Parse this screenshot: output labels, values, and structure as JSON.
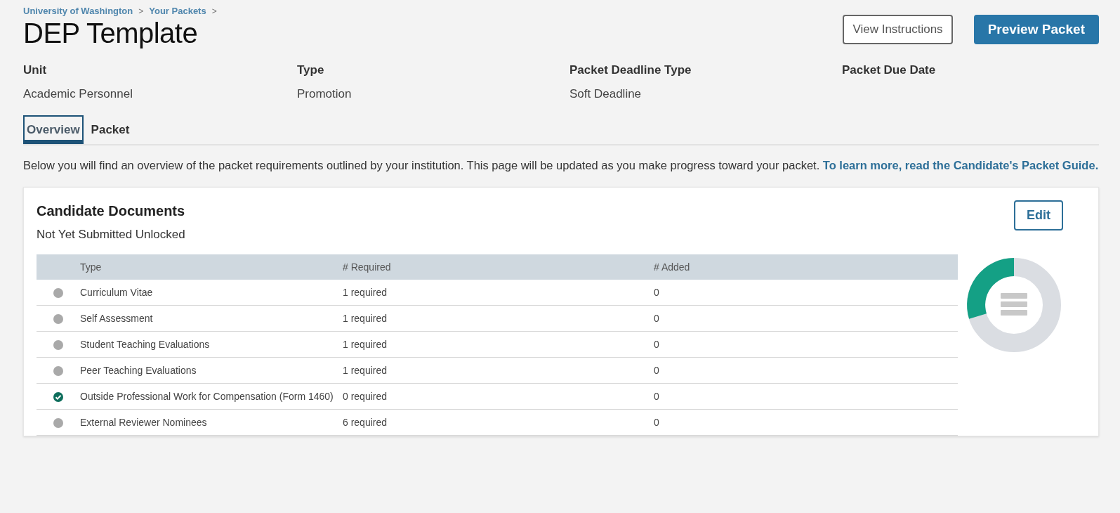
{
  "breadcrumb": [
    "University of Washington",
    "Your Packets"
  ],
  "breadcrumb_separator": ">",
  "title": "DEP Template",
  "buttons": [
    {
      "label": "View Instructions",
      "kind": "outline"
    },
    {
      "label": "Preview Packet",
      "kind": "primary"
    }
  ],
  "details": [
    {
      "label": "Unit",
      "value": "Academic Personnel"
    },
    {
      "label": "Type",
      "value": "Promotion"
    },
    {
      "label": "Packet Deadline Type",
      "value": "Soft Deadline"
    },
    {
      "label": "Packet Due Date"
    }
  ],
  "tabs": [
    {
      "label": "Overview",
      "selected": true
    },
    {
      "label": "Packet",
      "selected": false
    }
  ],
  "intro": {
    "text": "Below you will find an overview of the packet requirements outlined by your institution. This page will be updated as you make progress toward your packet.",
    "link": "To learn more, read the Candidate's Packet Guide."
  },
  "card": {
    "title": "Candidate Documents",
    "status": "Not Yet Submitted Unlocked",
    "edit_button": "Edit",
    "table": {
      "columns": [
        "Type",
        "# Required",
        "# Added"
      ],
      "rows": [
        {
          "type": "Curriculum Vitae",
          "required": "1 required",
          "added": "0",
          "done": false
        },
        {
          "type": "Self Assessment",
          "required": "1 required",
          "added": "0",
          "done": false
        },
        {
          "type": "Student Teaching Evaluations",
          "required": "1 required",
          "added": "0",
          "done": false
        },
        {
          "type": "Peer Teaching Evaluations",
          "required": "1 required",
          "added": "0",
          "done": false
        },
        {
          "type": "Outside Professional Work for Compensation (Form 1460)",
          "required": "0 required",
          "added": "0",
          "done": true
        },
        {
          "type": "External Reviewer Nominees",
          "required": "6 required",
          "added": "0",
          "done": false
        }
      ]
    }
  }
}
